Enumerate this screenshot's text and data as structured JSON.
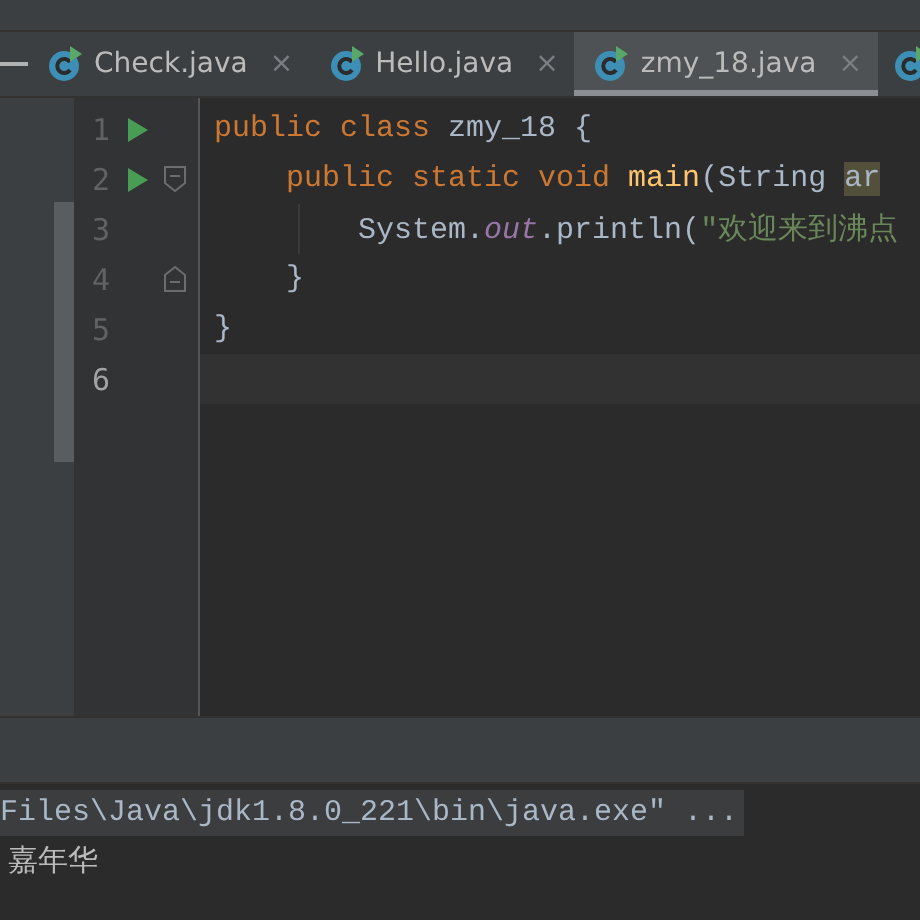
{
  "tabs": [
    {
      "label": "Check.java",
      "close": "×",
      "selected": false
    },
    {
      "label": "Hello.java",
      "close": "×",
      "selected": false
    },
    {
      "label": "zmy_18.java",
      "close": "×",
      "selected": true
    }
  ],
  "editor": {
    "lines": [
      {
        "number": "1",
        "run": true,
        "fold_open": false,
        "fold_close": false,
        "current": false,
        "guide": false,
        "tokens": [
          {
            "kind": "keyword",
            "text": "public class "
          },
          {
            "kind": "plain",
            "text": "zmy_18 {"
          }
        ]
      },
      {
        "number": "2",
        "run": true,
        "fold_open": true,
        "fold_close": false,
        "current": false,
        "guide": false,
        "tokens": [
          {
            "kind": "keyword",
            "text": "    public static void "
          },
          {
            "kind": "method",
            "text": "main"
          },
          {
            "kind": "plain",
            "text": "(String "
          },
          {
            "kind": "highlight",
            "text": "ar"
          }
        ]
      },
      {
        "number": "3",
        "run": false,
        "fold_open": false,
        "fold_close": false,
        "current": false,
        "guide": true,
        "tokens": [
          {
            "kind": "plain",
            "text": "        System."
          },
          {
            "kind": "field",
            "text": "out"
          },
          {
            "kind": "plain",
            "text": ".println("
          },
          {
            "kind": "string",
            "text": "\"欢迎来到沸点"
          }
        ]
      },
      {
        "number": "4",
        "run": false,
        "fold_open": false,
        "fold_close": true,
        "current": false,
        "guide": false,
        "tokens": [
          {
            "kind": "plain",
            "text": "    }"
          }
        ]
      },
      {
        "number": "5",
        "run": false,
        "fold_open": false,
        "fold_close": false,
        "current": false,
        "guide": false,
        "tokens": [
          {
            "kind": "plain",
            "text": "}"
          }
        ]
      },
      {
        "number": "6",
        "run": false,
        "fold_open": false,
        "fold_close": false,
        "current": true,
        "guide": false
      }
    ]
  },
  "console": {
    "lines": [
      {
        "text": "Files\\Java\\jdk1.8.0_221\\bin\\java.exe\" ...",
        "selected": true
      },
      {
        "text": "嘉年华",
        "selected": false
      }
    ]
  }
}
